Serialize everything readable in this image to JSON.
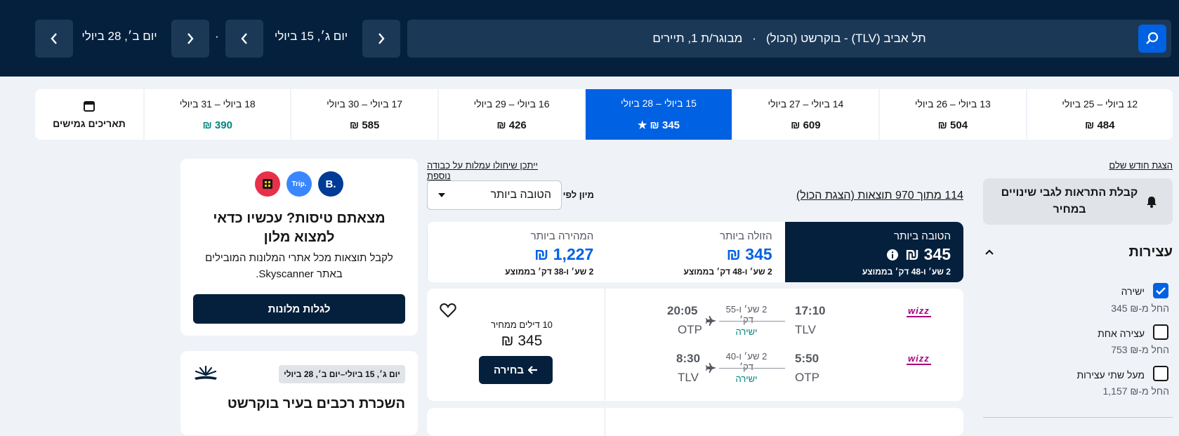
{
  "search": {
    "route": "תל אביב (TLV) - בוקרשט (הכול)",
    "sep": "·",
    "travellers": "מבוגר/ת 1, תיירים",
    "depart_date": "יום ג׳, 15 ביולי",
    "mid_sep": "·",
    "return_date": "יום ב׳, 28 ביולי"
  },
  "date_strip": [
    {
      "dates": "12 ביולי – 25 ביולי",
      "price": "484 ₪",
      "selected": false
    },
    {
      "dates": "13 ביולי – 26 ביולי",
      "price": "504 ₪",
      "selected": false
    },
    {
      "dates": "14 ביולי – 27 ביולי",
      "price": "609 ₪",
      "selected": false
    },
    {
      "dates": "15 ביולי – 28 ביולי",
      "price": "345 ₪ ★",
      "selected": true
    },
    {
      "dates": "16 ביולי – 29 ביולי",
      "price": "426 ₪",
      "selected": false
    },
    {
      "dates": "17 ביולי – 30 ביולי",
      "price": "585 ₪",
      "selected": false
    },
    {
      "dates": "18 ביולי – 31 ביולי",
      "price": "390 ₪",
      "selected": false
    }
  ],
  "flexible_dates": "תאריכים גמישים",
  "filters": {
    "show_month": "הצגת חודש שלם",
    "price_alert": "קבלת התראות לגבי שינויים במחיר",
    "stops_title": "עצירות",
    "options": [
      {
        "label": "ישירה",
        "price": "החל מ-₪ 345",
        "checked": true
      },
      {
        "label": "עצירה אחת",
        "price": "החל מ-₪ 753",
        "checked": false
      },
      {
        "label": "מעל שתי עצירות",
        "price": "החל מ-₪ 1,157",
        "checked": false
      }
    ]
  },
  "results": {
    "baggage_note": "ייתכן שיחולו עמלות על כבודה נוספת",
    "count_text": "114 מתוך 970 תוצאות (הצגת הכול)",
    "sort_label": "מיון לפי",
    "sort_value": "הטובה ביותר",
    "tabs": [
      {
        "title": "הטובה ביותר",
        "price": "345 ₪",
        "sub": "2 שע׳ ו-48 דק׳ בממוצע"
      },
      {
        "title": "הזולה ביותר",
        "price": "345 ₪",
        "sub": "2 שע׳ ו-48 דק׳ בממוצע"
      },
      {
        "title": "המהירה ביותר",
        "price": "1,227 ₪",
        "sub": "2 שע׳ ו-38 דק׳ בממוצע"
      }
    ],
    "flight": {
      "airline": "wizz",
      "outbound": {
        "dep_time": "17:10",
        "dep_code": "TLV",
        "duration": "2 שע׳ ו-55 דק׳",
        "stops": "ישירה",
        "arr_time": "20:05",
        "arr_code": "OTP"
      },
      "inbound": {
        "dep_time": "5:50",
        "dep_code": "OTP",
        "duration": "2 שע׳ ו-40 דק׳",
        "stops": "ישירה",
        "arr_time": "8:30",
        "arr_code": "TLV"
      },
      "deals": "10 דילים ממחיר",
      "price": "345 ₪",
      "select": "בחירה"
    }
  },
  "promo": {
    "logos": [
      "B.",
      "Trip.",
      "H"
    ],
    "title": "מצאתם טיסות? עכשיו כדאי למצוא מלון",
    "body": "לקבל תוצאות מכל אתרי המלונות המובילים באתר Skyscanner.",
    "button": "לגלות מלונות"
  },
  "car": {
    "dates": "יום ג׳, 15 ביולי–יום ב׳, 28 ביולי",
    "title": "השכרת רכבים בעיר בוקרשט"
  },
  "colors": {
    "navy": "#05203c",
    "blue": "#0062e3",
    "teal": "#00857e"
  }
}
